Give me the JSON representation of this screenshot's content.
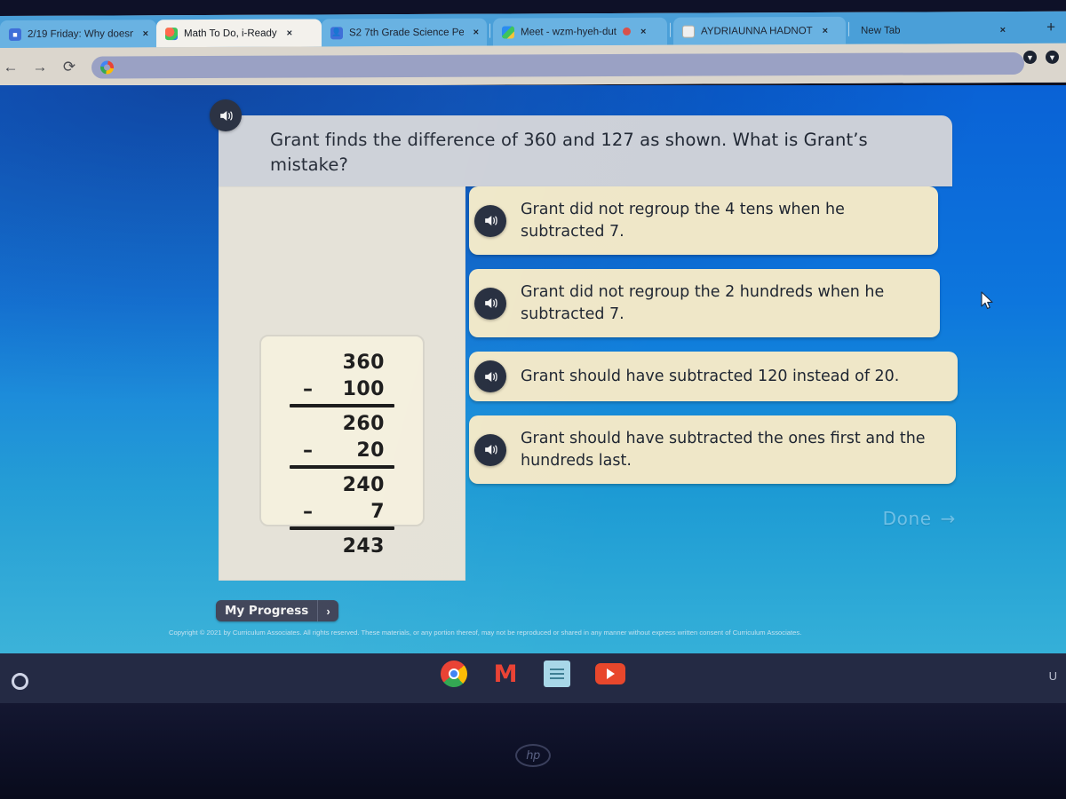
{
  "browser": {
    "tabs": [
      {
        "title": "2/19 Friday: Why doesn",
        "favicon": "drive-doc-icon",
        "state": "background",
        "close_label": "×"
      },
      {
        "title": "Math To Do, i-Ready",
        "favicon": "iready-icon",
        "state": "active",
        "close_label": "×"
      },
      {
        "title": "S2 7th Grade Science Pe",
        "favicon": "classroom-icon",
        "state": "background",
        "close_label": "×"
      },
      {
        "title": "Meet - wzm-hyeh-dut",
        "favicon": "meet-icon",
        "state": "background",
        "recording": true,
        "close_label": "×"
      },
      {
        "title": "AYDRIAUNNA HADNOT",
        "favicon": "docs-icon",
        "state": "background",
        "close_label": "×"
      },
      {
        "title": "New Tab",
        "favicon": "none",
        "state": "background",
        "close_label": "×"
      }
    ],
    "new_tab_label": "+",
    "nav": {
      "back": "←",
      "forward": "→",
      "reload": "⟳"
    },
    "omnibox": {
      "value": "",
      "placeholder": "",
      "search_engine_icon": "google-icon"
    },
    "extensions": [
      "shield-extension-icon",
      "shield-extension-icon"
    ]
  },
  "lesson": {
    "question": "Grant finds the difference of 360 and 127 as shown. What is Grant’s mistake?",
    "speaker_icon": "speaker-icon",
    "work": {
      "rows": [
        {
          "op": "",
          "num": "360",
          "rule_after": false
        },
        {
          "op": "–",
          "num": "100",
          "rule_after": true
        },
        {
          "op": "",
          "num": "260",
          "rule_after": false
        },
        {
          "op": "–",
          "num": "20",
          "rule_after": true
        },
        {
          "op": "",
          "num": "240",
          "rule_after": false
        },
        {
          "op": "–",
          "num": "7",
          "rule_after": true
        },
        {
          "op": "",
          "num": "243",
          "rule_after": false
        }
      ]
    },
    "choices": [
      {
        "text": "Grant did not regroup the 4 tens when he subtracted 7.",
        "selected": false
      },
      {
        "text": "Grant did not regroup the 2 hundreds when he subtracted 7.",
        "selected": false
      },
      {
        "text": "Grant should have subtracted 120 instead of 20.",
        "selected": false
      },
      {
        "text": "Grant should have subtracted the ones first and the hundreds last.",
        "selected": false
      }
    ],
    "done_button": {
      "label": "Done",
      "arrow": "→",
      "enabled": false
    },
    "my_progress": {
      "label": "My Progress",
      "arrow": "›"
    },
    "copyright": "Copyright © 2021 by Curriculum Associates. All rights reserved. These materials, or any portion thereof, may not be reproduced or shared in any manner without express written consent of Curriculum Associates."
  },
  "shelf": {
    "launcher_icon": "launcher-circle-icon",
    "apps": [
      {
        "name": "chrome-icon",
        "label": "Chrome"
      },
      {
        "name": "gmail-icon",
        "label": "M"
      },
      {
        "name": "google-docs-icon",
        "label": "Docs"
      },
      {
        "name": "youtube-icon",
        "label": "YouTube"
      }
    ],
    "status_label": "U"
  },
  "device": {
    "logo": "hp"
  },
  "colors": {
    "page_blue_top": "#0a62d6",
    "page_blue_bottom": "#35b0d8",
    "choice_cream": "#efe7c8",
    "question_gray": "#ccd0d8",
    "speaker_dark": "#242c3d",
    "tabstrip_blue": "#4a9fd8",
    "shelf_dark": "#242a44"
  }
}
